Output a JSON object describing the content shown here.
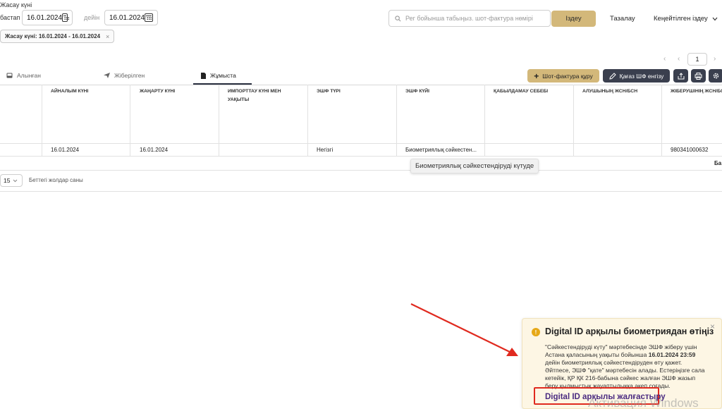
{
  "filters": {
    "date_label": "Жасау күні",
    "from_label": "бастап",
    "from_value": "16.01.2024",
    "to_label": "дейін",
    "to_value": "16.01.2024",
    "search_placeholder": "Рег бойынша табыңыз. шот-фактура нөмірі",
    "search_button": "Іздеу",
    "clear_button": "Тазалау",
    "advanced_search": "Кеңейтілген іздеу",
    "active_chip": "Жасау күні: 16.01.2024 - 16.01.2024"
  },
  "pagination": {
    "page": "1"
  },
  "tabs": [
    {
      "label": "Алынған",
      "icon": "inbox-icon"
    },
    {
      "label": "Жіберілген",
      "icon": "send-icon"
    },
    {
      "label": "Жұмыста",
      "icon": "document-icon"
    }
  ],
  "actions": {
    "create_invoice": "Шот-фактура құру",
    "paper_invoice": "Қағаз ШФ енгізу"
  },
  "table": {
    "headers": [
      "АЙНАЛЫМ КҮНІ",
      "ЖАҢАРТУ КҮНІ",
      "ИМПОРТТАУ КҮНІ МЕН УАҚЫТЫ",
      "ЭШФ ТҮРІ",
      "ЭШФ КҮЙІ",
      "ҚАБЫЛДАМАУ СЕБЕБІ",
      "АЛУШЫНЫҢ ЖСН/БСН",
      "ЖІБЕРУШІНІҢ ЖСН/БСН"
    ],
    "row": [
      "16.01.2024",
      "16.01.2024",
      "",
      "Негізгі",
      "Биометриялық сәйкестен...",
      "",
      "",
      "980341000632"
    ],
    "overflow_cell": "Ба",
    "tooltip": "Биометриялық сәйкестендіруді күтуде"
  },
  "rows_per_page": {
    "value": "15",
    "label": "Беттегі жолдар саны"
  },
  "notification": {
    "title": "Digital ID арқылы биометриядан өтіңіз",
    "line1": "\"Сәйкестендіруді күту\" мәртебесінде ЭШФ жіберу үшін",
    "line2_prefix": "Астана қаласының уақыты бойынша ",
    "line2_bold": "16.01.2024 23:59",
    "line3": "дейін биометриялық сәйкестендіруден өту қажет.",
    "line4": "Әйтпесе, ЭШФ \"қате\" мәртебесін алады. Естеріңізге сала",
    "line5": "кетейік, ҚР ҚК 216-бабына сәйкес жалған ЭШФ жазып",
    "line6": "беру қылмыстық жауаптылыққа әкеп соғады.",
    "cta": "Digital ID арқылы жалғастыру"
  },
  "watermark": "Активация Windows",
  "colors": {
    "gold": "#d3b87a",
    "dark_button": "#3a3f4e",
    "notification_bg": "#fdf6e4",
    "annotation_red": "#e02a1f",
    "cta_purple": "#4a2a80"
  }
}
